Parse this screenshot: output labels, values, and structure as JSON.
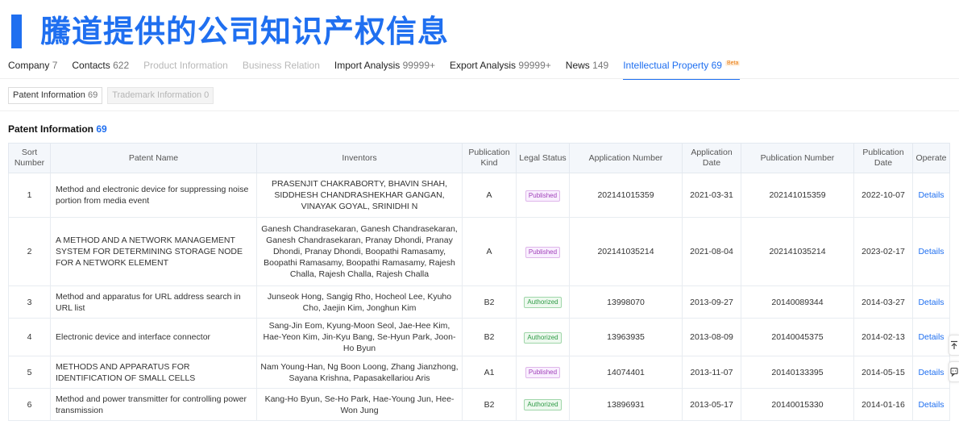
{
  "page_title": "騰道提供的公司知识产权信息",
  "tabs": [
    {
      "label": "Company",
      "count": "7",
      "state": "normal"
    },
    {
      "label": "Contacts",
      "count": "622",
      "state": "normal"
    },
    {
      "label": "Product Information",
      "count": "",
      "state": "disabled"
    },
    {
      "label": "Business Relation",
      "count": "",
      "state": "disabled"
    },
    {
      "label": "Import Analysis",
      "count": "99999+",
      "state": "normal"
    },
    {
      "label": "Export Analysis",
      "count": "99999+",
      "state": "normal"
    },
    {
      "label": "News",
      "count": "149",
      "state": "normal"
    },
    {
      "label": "Intellectual Property",
      "count": "69",
      "state": "active",
      "badge": "Beta"
    }
  ],
  "subtabs": [
    {
      "label": "Patent Information",
      "count": "69",
      "state": "selected"
    },
    {
      "label": "Trademark Information",
      "count": "0",
      "state": "disabled"
    }
  ],
  "section": {
    "label": "Patent Information",
    "count": "69"
  },
  "table": {
    "headers": [
      "Sort Number",
      "Patent Name",
      "Inventors",
      "Publication Kind",
      "Legal Status",
      "Application Number",
      "Application Date",
      "Publication Number",
      "Publication Date",
      "Operate"
    ],
    "rows": [
      {
        "sort": "1",
        "name": "Method and electronic device for suppressing noise portion from media event",
        "inventors": "PRASENJIT CHAKRABORTY, BHAVIN SHAH, SIDDHESH CHANDRASHEKHAR GANGAN, VINAYAK GOYAL, SRINIDHI N",
        "kind": "A",
        "status": "Published",
        "app_no": "202141015359",
        "app_date": "2021-03-31",
        "pub_no": "202141015359",
        "pub_date": "2022-10-07",
        "op": "Details"
      },
      {
        "sort": "2",
        "name": "A METHOD AND A NETWORK MANAGEMENT SYSTEM FOR DETERMINING STORAGE NODE FOR A NETWORK ELEMENT",
        "inventors": "Ganesh Chandrasekaran, Ganesh Chandrasekaran, Ganesh Chandrasekaran, Pranay Dhondi, Pranay Dhondi, Pranay Dhondi, Boopathi Ramasamy, Boopathi Ramasamy, Boopathi Ramasamy, Rajesh Challa, Rajesh Challa, Rajesh Challa",
        "kind": "A",
        "status": "Published",
        "app_no": "202141035214",
        "app_date": "2021-08-04",
        "pub_no": "202141035214",
        "pub_date": "2023-02-17",
        "op": "Details"
      },
      {
        "sort": "3",
        "name": "Method and apparatus for URL address search in URL list",
        "inventors": "Junseok Hong, Sangig Rho, Hocheol Lee, Kyuho Cho, Jaejin Kim, Jonghun Kim",
        "kind": "B2",
        "status": "Authorized",
        "app_no": "13998070",
        "app_date": "2013-09-27",
        "pub_no": "20140089344",
        "pub_date": "2014-03-27",
        "op": "Details"
      },
      {
        "sort": "4",
        "name": "Electronic device and interface connector",
        "inventors": "Sang-Jin Eom, Kyung-Moon Seol, Jae-Hee Kim, Hae-Yeon Kim, Jin-Kyu Bang, Se-Hyun Park, Joon-Ho Byun",
        "kind": "B2",
        "status": "Authorized",
        "app_no": "13963935",
        "app_date": "2013-08-09",
        "pub_no": "20140045375",
        "pub_date": "2014-02-13",
        "op": "Details"
      },
      {
        "sort": "5",
        "name": "METHODS AND APPARATUS FOR IDENTIFICATION OF SMALL CELLS",
        "inventors": "Nam Young-Han, Ng Boon Loong, Zhang Jianzhong, Sayana Krishna, Papasakellariou Aris",
        "kind": "A1",
        "status": "Published",
        "app_no": "14074401",
        "app_date": "2013-11-07",
        "pub_no": "20140133395",
        "pub_date": "2014-05-15",
        "op": "Details"
      },
      {
        "sort": "6",
        "name": "Method and power transmitter for controlling power transmission",
        "inventors": "Kang-Ho Byun, Se-Ho Park, Hae-Young Jun, Hee-Won Jung",
        "kind": "B2",
        "status": "Authorized",
        "app_no": "13896931",
        "app_date": "2013-05-17",
        "pub_no": "20140015330",
        "pub_date": "2014-01-16",
        "op": "Details"
      }
    ]
  },
  "side_buttons": [
    {
      "icon": "back-to-top-icon"
    },
    {
      "icon": "chat-icon"
    }
  ],
  "colors": {
    "accent": "#1f6ff0",
    "published": "#a03fb8",
    "authorized": "#2e9b46",
    "beta": "#e8780c"
  }
}
